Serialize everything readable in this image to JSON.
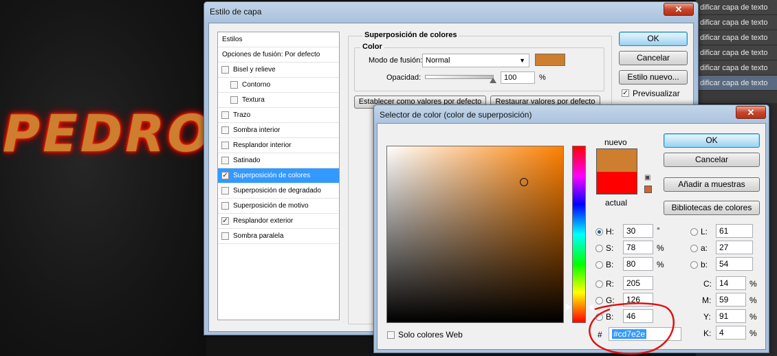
{
  "canvas": {
    "text": "PEDRO"
  },
  "layers_panel": {
    "items": [
      {
        "label": "dificar capa de texto"
      },
      {
        "label": "dificar capa de texto"
      },
      {
        "label": "dificar capa de texto"
      },
      {
        "label": "dificar capa de texto"
      },
      {
        "label": "dificar capa de texto"
      },
      {
        "label": "dificar capa de texto"
      }
    ]
  },
  "layer_style": {
    "title": "Estilo de capa",
    "close_glyph": "✕",
    "styles_header": "Estilos",
    "blend_options": "Opciones de fusión: Por defecto",
    "styles": [
      {
        "label": "Bisel y relieve",
        "checked": false,
        "sub": false
      },
      {
        "label": "Contorno",
        "checked": false,
        "sub": true
      },
      {
        "label": "Textura",
        "checked": false,
        "sub": true
      },
      {
        "label": "Trazo",
        "checked": false,
        "sub": false
      },
      {
        "label": "Sombra interior",
        "checked": false,
        "sub": false
      },
      {
        "label": "Resplandor interior",
        "checked": false,
        "sub": false
      },
      {
        "label": "Satinado",
        "checked": false,
        "sub": false
      },
      {
        "label": "Superposición de colores",
        "checked": true,
        "sub": false,
        "selected": true
      },
      {
        "label": "Superposición de degradado",
        "checked": false,
        "sub": false
      },
      {
        "label": "Superposición de motivo",
        "checked": false,
        "sub": false
      },
      {
        "label": "Resplandor exterior",
        "checked": true,
        "sub": false
      },
      {
        "label": "Sombra paralela",
        "checked": false,
        "sub": false
      }
    ],
    "section_title": "Superposición de colores",
    "color_group": "Color",
    "blend_mode_label": "Modo de fusión:",
    "blend_mode_value": "Normal",
    "overlay_color": "#cd7e2e",
    "opacity_label": "Opacidad:",
    "opacity_value": "100",
    "opacity_unit": "%",
    "set_default": "Establecer como valores por defecto",
    "reset_default": "Restaurar valores por defecto",
    "ok": "OK",
    "cancel": "Cancelar",
    "new_style": "Estilo nuevo...",
    "preview": "Previsualizar",
    "preview_checked": true
  },
  "color_picker": {
    "title": "Selector de color (color de superposición)",
    "close_glyph": "✕",
    "new_label": "nuevo",
    "current_label": "actual",
    "new_color": "#cd7e2e",
    "current_color": "#ff0000",
    "ok": "OK",
    "cancel": "Cancelar",
    "add_swatch": "Añadir a muestras",
    "libraries": "Bibliotecas de colores",
    "fields": {
      "H": {
        "label": "H:",
        "value": "30",
        "unit": "°"
      },
      "S": {
        "label": "S:",
        "value": "78",
        "unit": "%"
      },
      "Bv": {
        "label": "B:",
        "value": "80",
        "unit": "%"
      },
      "R": {
        "label": "R:",
        "value": "205"
      },
      "G": {
        "label": "G:",
        "value": "126"
      },
      "Bc": {
        "label": "B:",
        "value": "46"
      },
      "L": {
        "label": "L:",
        "value": "61"
      },
      "a": {
        "label": "a:",
        "value": "27"
      },
      "b": {
        "label": "b:",
        "value": "54"
      },
      "C": {
        "label": "C:",
        "value": "14",
        "unit": "%"
      },
      "M": {
        "label": "M:",
        "value": "59",
        "unit": "%"
      },
      "Y": {
        "label": "Y:",
        "value": "91",
        "unit": "%"
      },
      "K": {
        "label": "K:",
        "value": "4",
        "unit": "%"
      }
    },
    "hex_label": "#",
    "hex_value": "#cd7e2e",
    "web_only": "Solo colores Web"
  }
}
